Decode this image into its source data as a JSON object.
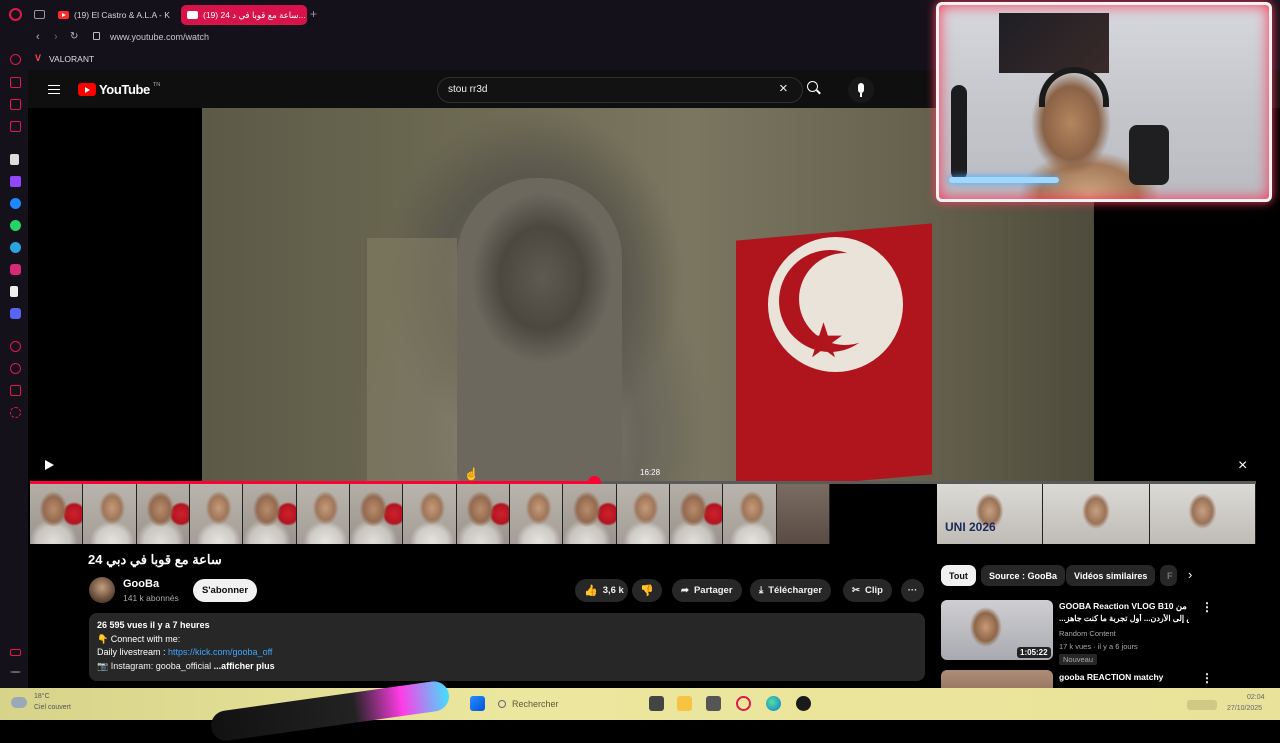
{
  "browser": {
    "tabs": [
      {
        "label": "(19) El Castro & A.L.A - K"
      },
      {
        "label": "(19) 24 ساعة مع قوبا في د..."
      }
    ],
    "address": "www.youtube.com/watch",
    "bookmark": "VALORANT",
    "new_tab_glyph": "+"
  },
  "youtube": {
    "logo_text": "YouTube",
    "logo_suffix": "TN",
    "search_value": "stou rr3d",
    "player": {
      "time_tooltip": "16:28",
      "progress_fraction": 0.46
    },
    "video": {
      "title": "24 ساعة مع قوبا في دبي",
      "channel": "GooBa",
      "subscribers": "141 k abonnés",
      "subscribe_label": "S'abonner",
      "likes": "3,6 k",
      "share_label": "Partager",
      "download_label": "Télécharger",
      "clip_label": "Clip",
      "more_glyph": "···",
      "description": {
        "stats": "26 595 vues  il y a 7 heures",
        "line1": "👇 Connect with me:",
        "line2_prefix": "Daily livestream : ",
        "line2_link": "https://kick.com/gooba_off",
        "line3": "📷 Instagram: gooba_official",
        "more": "...afficher plus"
      }
    },
    "chips": [
      "Tout",
      "Source : GooBa",
      "Vidéos similaires",
      "F"
    ],
    "recommendations": [
      {
        "title": "GOOBA Reaction VLOG B10 من",
        "title2": "...ليس إلى الأردن... أول تجربة ما كنت جاهز",
        "channel": "Random Content",
        "meta": "17 k vues · il y a 6 jours",
        "badge": "Nouveau",
        "duration": "1:05:22"
      },
      {
        "title": "gooba REACTION matchy",
        "channel": "",
        "meta": "",
        "badge": "",
        "duration": ""
      }
    ],
    "related_strip_text": "UNI 2026"
  },
  "taskbar": {
    "weather_temp": "18°C",
    "weather_desc": "Ciel couvert",
    "search_placeholder": "Rechercher",
    "time": "02:04",
    "date": "27/10/2025"
  },
  "colors": {
    "accent_red": "#ff0033",
    "opera_tab": "#d8124a",
    "link_blue": "#3ea6ff"
  }
}
